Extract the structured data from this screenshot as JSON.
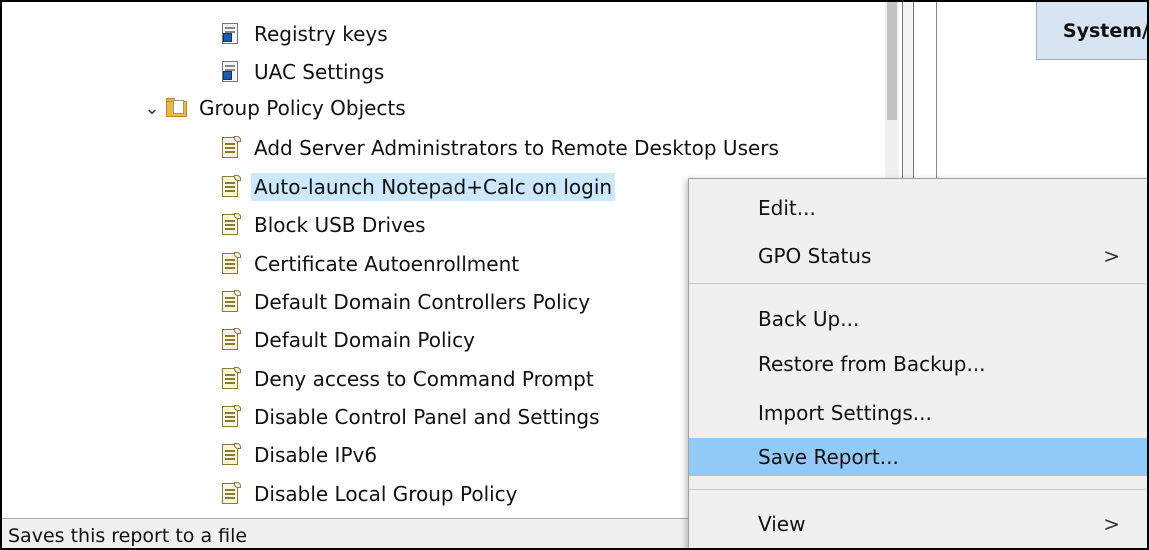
{
  "tree": {
    "items": [
      {
        "label": "Registry keys",
        "icon": "setting-icon"
      },
      {
        "label": "UAC Settings",
        "icon": "setting-icon"
      },
      {
        "label": "Group Policy Objects",
        "icon": "folder-icon",
        "expanded": true
      },
      {
        "label": "Add Server Administrators to Remote Desktop Users",
        "icon": "policy-icon"
      },
      {
        "label": "Auto-launch Notepad+Calc on login",
        "icon": "policy-icon",
        "selected": true
      },
      {
        "label": "Block USB Drives",
        "icon": "policy-icon"
      },
      {
        "label": "Certificate Autoenrollment",
        "icon": "policy-icon"
      },
      {
        "label": "Default Domain Controllers Policy",
        "icon": "policy-icon"
      },
      {
        "label": "Default Domain Policy",
        "icon": "policy-icon"
      },
      {
        "label": "Deny access to Command Prompt",
        "icon": "policy-icon"
      },
      {
        "label": "Disable Control Panel and Settings",
        "icon": "policy-icon"
      },
      {
        "label": "Disable IPv6",
        "icon": "policy-icon"
      },
      {
        "label": "Disable Local Group Policy",
        "icon": "policy-icon"
      }
    ]
  },
  "right_pane": {
    "column_header": "System/"
  },
  "status_bar": {
    "text": "Saves this report to a file"
  },
  "context_menu": {
    "items": [
      {
        "label": "Edit...",
        "submenu": false
      },
      {
        "label": "GPO Status",
        "submenu": true,
        "arrow": ">"
      },
      {
        "label": "Back Up...",
        "submenu": false
      },
      {
        "label": "Restore from Backup...",
        "submenu": false
      },
      {
        "label": "Import Settings...",
        "submenu": false
      },
      {
        "label": "Save Report...",
        "submenu": false,
        "highlighted": true
      },
      {
        "label": "View",
        "submenu": true,
        "arrow": ">"
      }
    ]
  },
  "colors": {
    "selection": "#cce8ff",
    "menu_highlight": "#91c9f7",
    "menu_background": "#f0f0f0"
  }
}
